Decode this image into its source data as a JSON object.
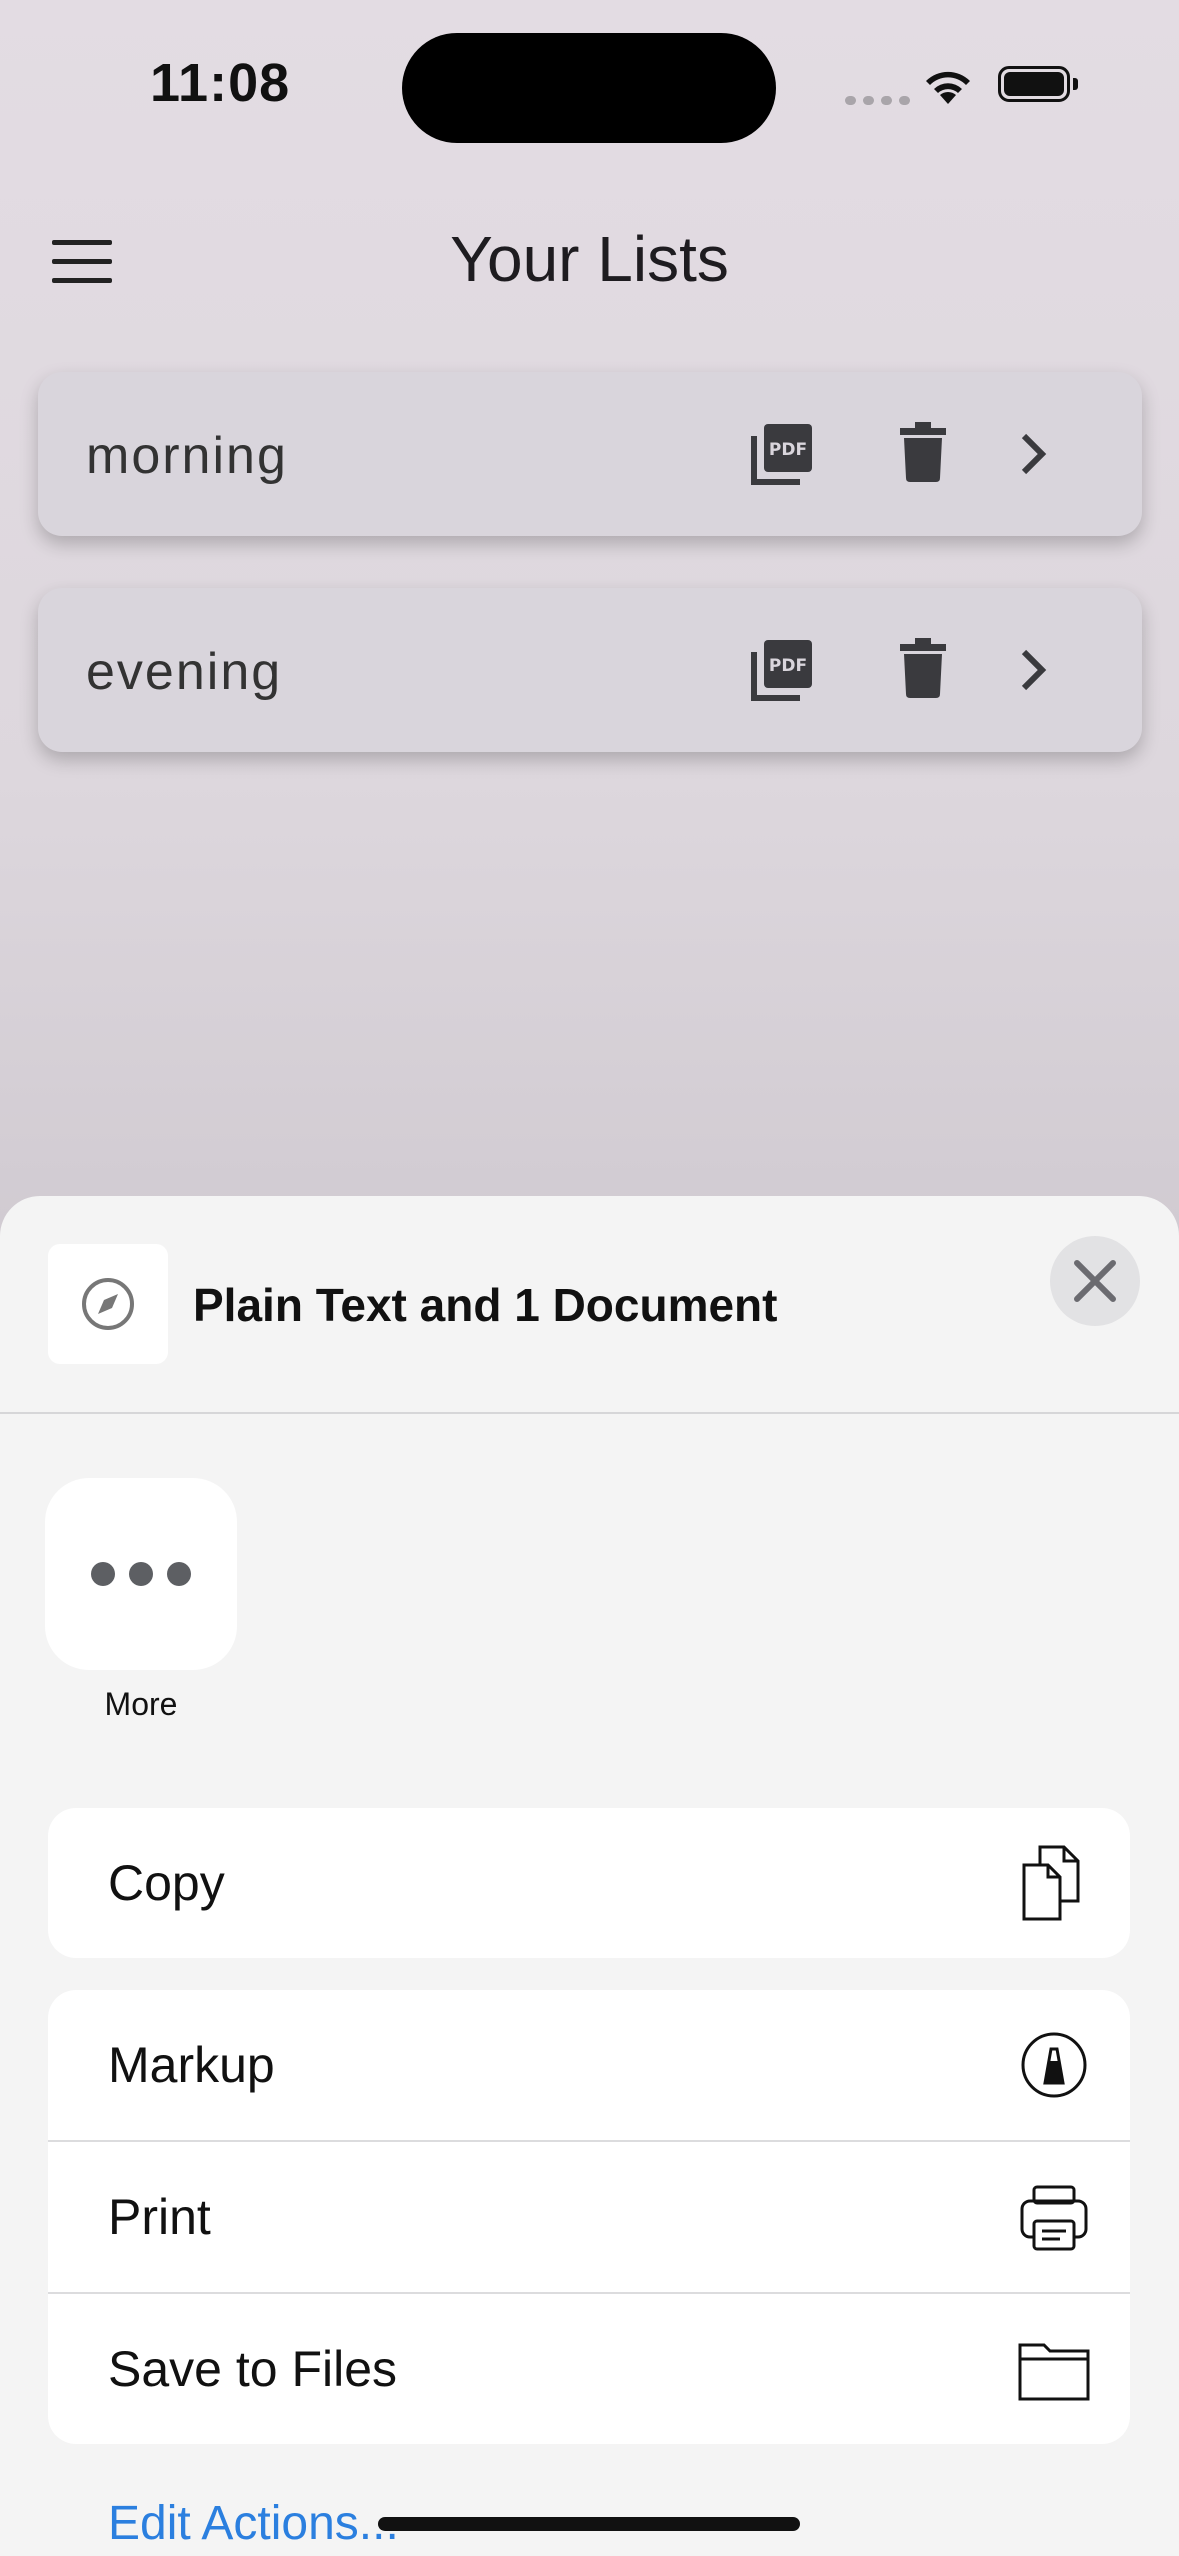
{
  "status_bar": {
    "time": "11:08"
  },
  "header": {
    "title": "Your Lists"
  },
  "lists": [
    {
      "name": "morning"
    },
    {
      "name": "evening"
    }
  ],
  "share_sheet": {
    "title": "Plain Text and 1 Document",
    "more_label": "More",
    "actions_group1": [
      {
        "label": "Copy",
        "icon": "copy-icon"
      }
    ],
    "actions_group2": [
      {
        "label": "Markup",
        "icon": "markup-icon"
      },
      {
        "label": "Print",
        "icon": "printer-icon"
      },
      {
        "label": "Save to Files",
        "icon": "folder-icon"
      }
    ],
    "edit_actions": "Edit Actions..."
  },
  "colors": {
    "link": "#2b7fdf",
    "card": "#d9d5dc",
    "sheet": "#f4f4f4"
  }
}
